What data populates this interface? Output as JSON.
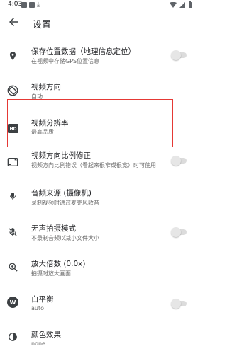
{
  "status_bar": {
    "time": "4:03"
  },
  "header": {
    "title": "设置"
  },
  "settings": [
    {
      "title": "保存位置数据（地理信息定位）",
      "subtitle": "在视频中存储GPS位置信息",
      "toggle": "off"
    },
    {
      "title": "视频方向",
      "subtitle": "自动"
    },
    {
      "title": "视频分辨率",
      "subtitle": "最高品质"
    },
    {
      "title": "视频方向比例修正",
      "subtitle": "视频方向比例错误（看起来很窄或很宽）时可使用",
      "toggle": "off"
    },
    {
      "title": "音频来源 (摄像机)",
      "subtitle": "录制视频时通过麦克风收音"
    },
    {
      "title": "无声拍摄模式",
      "subtitle": "不录制音频以减小文件大小",
      "toggle": "off"
    },
    {
      "title": "放大倍数 (0.0x)",
      "subtitle": "拍摄时放大画面"
    },
    {
      "title": "白平衡",
      "subtitle": "auto",
      "toggle": "off"
    },
    {
      "title": "颜色效果",
      "subtitle": "none"
    }
  ],
  "colors": {
    "highlight": "#e53935",
    "icon": "#3c4043",
    "secondary_text": "#6a6a6a"
  }
}
